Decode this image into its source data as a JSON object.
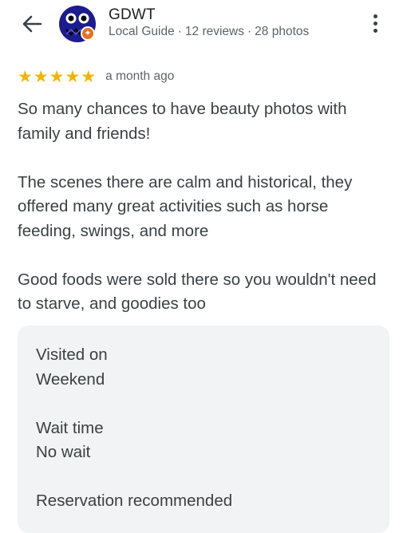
{
  "header": {
    "user_name": "GDWT",
    "local_guide": "Local Guide",
    "separator": "·",
    "reviews": "12 reviews",
    "photos": "28 photos"
  },
  "review": {
    "stars": 5,
    "time": "a month ago",
    "paragraphs": [
      "So many chances to have beauty photos with family and friends!",
      "The scenes there are calm and historical, they offered many great activities such as horse feeding, swings, and more",
      "Good foods were sold there so you wouldn't need to starve, and goodies too"
    ]
  },
  "details": {
    "visited_label": "Visited on",
    "visited_value": "Weekend",
    "wait_label": "Wait time",
    "wait_value": "No wait",
    "reservation_label": "Reservation recommended"
  },
  "colors": {
    "star": "#f4b400",
    "badge": "#e8711c",
    "avatar_bg": "#1c1c8e",
    "card_bg": "#f1f3f4"
  },
  "icons": {
    "back": "arrow-left-icon",
    "more": "more-vertical-icon",
    "badge": "local-guide-badge-icon",
    "star": "star-icon"
  }
}
